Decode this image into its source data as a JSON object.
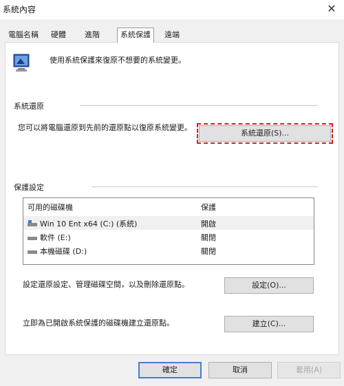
{
  "window": {
    "title": "系統內容",
    "close_glyph": "✕"
  },
  "tabs": [
    {
      "label": "電腦名稱"
    },
    {
      "label": "硬體"
    },
    {
      "label": "進階"
    },
    {
      "label": "系統保護"
    },
    {
      "label": "遠端"
    }
  ],
  "active_tab": "系統保護",
  "header": {
    "text": "使用系統保護來復原不想要的系統變更。"
  },
  "system_restore": {
    "group_label": "系統還原",
    "description": "您可以將電腦還原到先前的還原點以復原系統變更。",
    "button_label": "系統還原(S)..."
  },
  "protection": {
    "group_label": "保護設定",
    "columns": {
      "drive": "可用的磁碟機",
      "status": "保護"
    },
    "drives": [
      {
        "name": "Win 10 Ent x64 (C:) (系統)",
        "status": "開啟",
        "icon": "system-drive-icon"
      },
      {
        "name": "軟件 (E:)",
        "status": "關閉",
        "icon": "drive-icon"
      },
      {
        "name": "本機磁碟 (D:)",
        "status": "關閉",
        "icon": "drive-icon"
      }
    ],
    "configure_text": "設定還原設定、管理磁碟空間，以及刪除還原點。",
    "configure_button": "設定(O)...",
    "create_text": "立即為已開啟系統保護的磁碟機建立還原點。",
    "create_button": "建立(C)..."
  },
  "footer": {
    "ok": "確定",
    "cancel": "取消",
    "apply": "套用(A)"
  },
  "colors": {
    "highlight_outline": "#d02020",
    "default_button_border": "#4a7bd0",
    "dialog_background": "#f0f0f0"
  }
}
